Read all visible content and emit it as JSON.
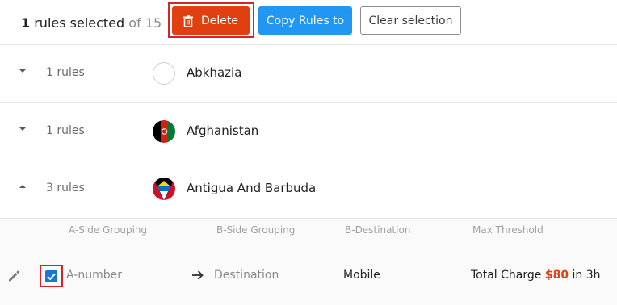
{
  "selection": {
    "count": "1",
    "label": " rules selected",
    "of_text": " of 15"
  },
  "toolbar": {
    "delete_label": "Delete",
    "copy_label": "Copy Rules to",
    "clear_label": "Clear selection"
  },
  "groups": [
    {
      "rules": "1 rules",
      "country": "Abkhazia",
      "flag": "none",
      "expanded": false
    },
    {
      "rules": "1 rules",
      "country": "Afghanistan",
      "flag": "afghanistan",
      "expanded": false
    },
    {
      "rules": "3 rules",
      "country": "Antigua And Barbuda",
      "flag": "antigua-and-barbuda",
      "expanded": true
    }
  ],
  "detail": {
    "headers": {
      "a_side": "A-Side Grouping",
      "b_side": "B-Side Grouping",
      "b_dest": "B-Destination",
      "max": "Max Threshold"
    },
    "row": {
      "a_side": "A-number",
      "b_side": "Destination",
      "b_dest": "Mobile",
      "threshold_prefix": "Total Charge ",
      "threshold_amount": "$80",
      "threshold_suffix": " in 3h",
      "checked": true
    }
  },
  "colors": {
    "delete": "#e0400f",
    "copy": "#2196f3",
    "checkbox": "#1976d2",
    "highlight": "#d6232a"
  }
}
